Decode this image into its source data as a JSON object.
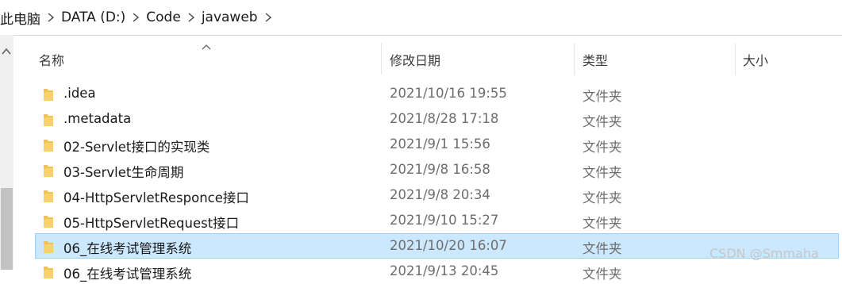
{
  "breadcrumb": [
    "此电脑",
    "DATA (D:)",
    "Code",
    "javaweb"
  ],
  "columns": {
    "name": "名称",
    "date": "修改日期",
    "type": "类型",
    "size": "大小"
  },
  "files": [
    {
      "name": ".idea",
      "date": "2021/10/16 19:55",
      "type": "文件夹",
      "selected": false
    },
    {
      "name": ".metadata",
      "date": "2021/8/28 17:18",
      "type": "文件夹",
      "selected": false
    },
    {
      "name": "02-Servlet接口的实现类",
      "date": "2021/9/1 15:56",
      "type": "文件夹",
      "selected": false
    },
    {
      "name": "03-Servlet生命周期",
      "date": "2021/9/8 16:58",
      "type": "文件夹",
      "selected": false
    },
    {
      "name": "04-HttpServletResponce接口",
      "date": "2021/9/8 20:34",
      "type": "文件夹",
      "selected": false
    },
    {
      "name": "05-HttpServletRequest接口",
      "date": "2021/9/10 15:27",
      "type": "文件夹",
      "selected": false
    },
    {
      "name": "06_在线考试管理系统",
      "date": "2021/10/20 16:07",
      "type": "文件夹",
      "selected": true
    },
    {
      "name": "06_在线考试管理系统",
      "date": "2021/9/13 20:45",
      "type": "文件夹",
      "selected": false
    }
  ],
  "watermark": "CSDN @Smmaha",
  "icons": {
    "folder": "folder-icon",
    "breadcrumb_separator": "chevron-right-icon",
    "sort": "sort-ascending-icon",
    "scroll_up": "scroll-up-arrow-icon"
  },
  "colors": {
    "selection_bg": "#cce8ff",
    "selection_border": "#99d1ff",
    "folder": "#f2c14e"
  }
}
